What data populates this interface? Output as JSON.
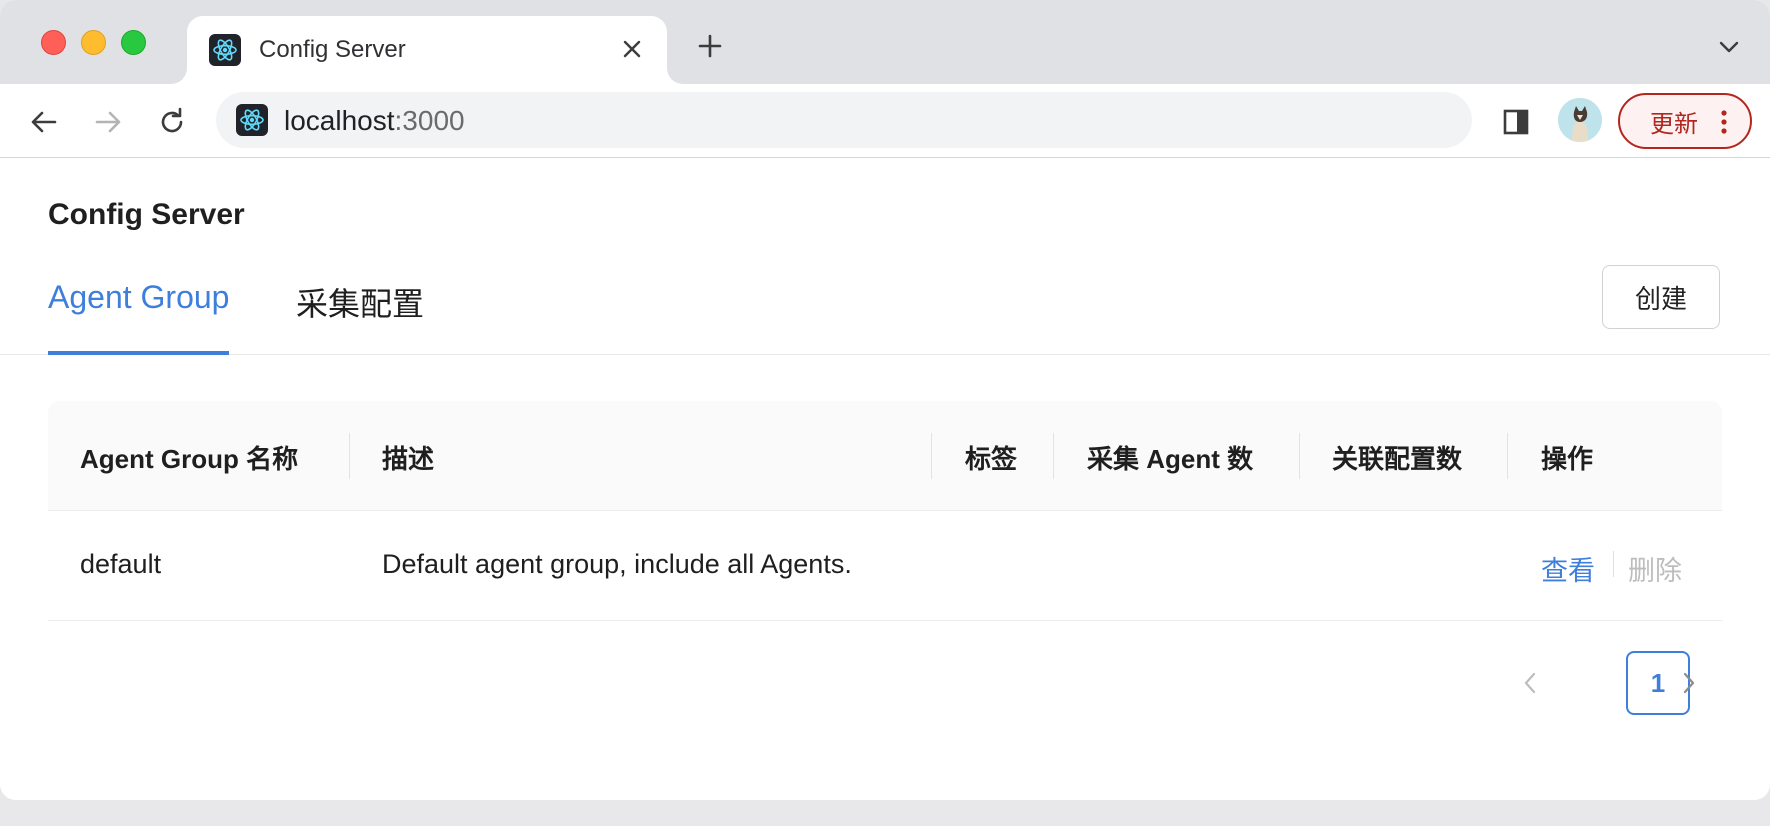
{
  "browser": {
    "tab_title": "Config Server",
    "url_host": "localhost",
    "url_port": ":3000",
    "update_label": "更新",
    "icons": [
      "react-favicon",
      "close-icon",
      "plus-icon",
      "chevron-down-icon",
      "back-arrow-icon",
      "forward-arrow-icon",
      "reload-icon",
      "side-panel-icon",
      "profile-avatar",
      "more-vert-icon"
    ]
  },
  "page": {
    "title": "Config Server",
    "tabs": [
      {
        "label": "Agent Group",
        "active": true
      },
      {
        "label": "采集配置",
        "active": false
      }
    ],
    "create_label": "创建"
  },
  "table": {
    "columns": [
      "Agent Group 名称",
      "描述",
      "标签",
      "采集 Agent 数",
      "关联配置数",
      "操作"
    ],
    "rows": [
      {
        "name": "default",
        "description": "Default agent group, include all Agents.",
        "tags": "",
        "agent_count": "",
        "config_count": "",
        "actions": [
          "查看",
          "删除"
        ]
      }
    ]
  },
  "pagination": {
    "current_page": "1"
  },
  "colors": {
    "accent": "#3f7fdc",
    "update_red": "#b3261e",
    "disabled_text": "#bdbdbd"
  }
}
